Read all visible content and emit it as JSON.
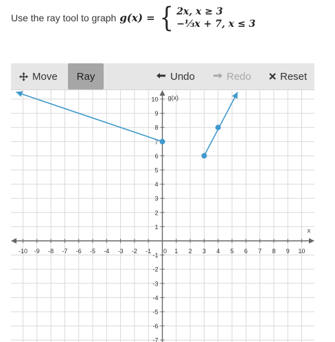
{
  "prompt": {
    "lead": "Use the ray tool to graph",
    "function": "g(x) =",
    "case1": "2x, x ≥ 3",
    "case2": "−⅓x + 7, x ≤ 3"
  },
  "toolbar": {
    "move_label": "Move",
    "ray_label": "Ray",
    "undo_label": "Undo",
    "redo_label": "Redo",
    "reset_label": "Reset",
    "active_tool": "ray"
  },
  "colors": {
    "ray": "#3f99cc",
    "toolbar_bg": "#e6e6e6",
    "active_tool_bg": "#a6a6a6",
    "grid": "#d9d9d9",
    "axis": "#666666",
    "disabled": "#a8a8a8"
  },
  "graph": {
    "x_axis_label": "x",
    "y_axis_label": "g(x)",
    "x_ticks": [
      -10,
      -9,
      -8,
      -7,
      -6,
      -5,
      -4,
      -3,
      -2,
      -1,
      0,
      1,
      2,
      3,
      4,
      5,
      6,
      7,
      8,
      9,
      10
    ],
    "y_ticks": [
      -7,
      -6,
      -5,
      -4,
      -3,
      -2,
      -1,
      1,
      2,
      3,
      4,
      5,
      6,
      7,
      8,
      9,
      10
    ],
    "x_range": [
      -10.5,
      10.5
    ],
    "y_range": [
      -7,
      10.5
    ],
    "rays": [
      {
        "name": "ray-1",
        "start": [
          0,
          7
        ],
        "through": [
          -10.5,
          10.5
        ]
      },
      {
        "name": "ray-2",
        "start": [
          3,
          6
        ],
        "through": [
          5.4,
          10.5
        ]
      }
    ],
    "points": [
      {
        "name": "point-0-7",
        "x": 0,
        "y": 7
      },
      {
        "name": "point-3-6",
        "x": 3,
        "y": 6
      },
      {
        "name": "point-4-8",
        "x": 4,
        "y": 8
      }
    ]
  }
}
